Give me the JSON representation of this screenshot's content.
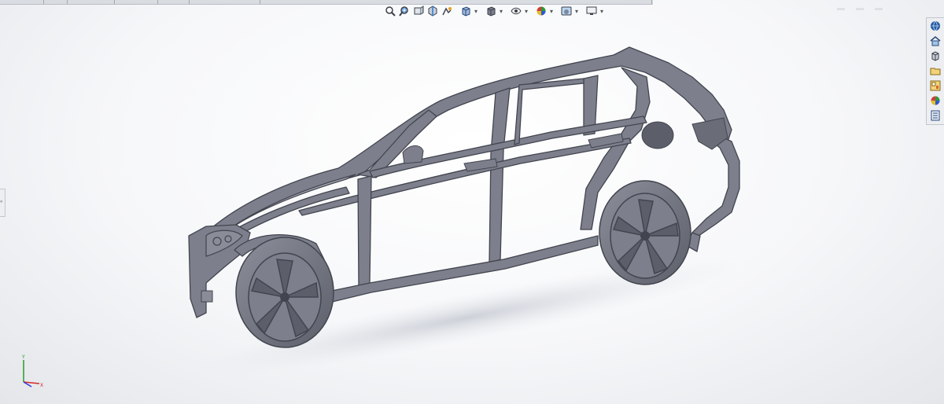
{
  "window": {
    "left_tab_glyph": "«"
  },
  "view_toolbar": {
    "tools": [
      {
        "name": "zoom-to-fit-icon"
      },
      {
        "name": "zoom-to-area-icon"
      },
      {
        "name": "previous-view-icon"
      },
      {
        "name": "section-view-icon"
      },
      {
        "name": "dynamic-annotation-icon"
      },
      {
        "name": "view-orientation-icon",
        "dropdown": true
      },
      {
        "name": "display-style-icon",
        "dropdown": true
      },
      {
        "name": "hide-show-items-icon",
        "dropdown": true
      },
      {
        "name": "edit-appearance-icon",
        "dropdown": true
      },
      {
        "name": "apply-scene-icon",
        "dropdown": true
      },
      {
        "name": "view-settings-icon",
        "dropdown": true
      }
    ],
    "dropdown_glyph": "▾"
  },
  "task_pane": {
    "buttons": [
      {
        "name": "solidworks-resources-icon"
      },
      {
        "name": "home-icon"
      },
      {
        "name": "design-library-icon"
      },
      {
        "name": "file-explorer-icon"
      },
      {
        "name": "view-palette-icon"
      },
      {
        "name": "appearances-scenes-icon"
      },
      {
        "name": "custom-properties-icon"
      }
    ]
  },
  "triad": {
    "axis_y": "Y",
    "axis_x": "X",
    "colors": {
      "x": "#d62a2a",
      "y": "#2a9a2a",
      "z": "#2a3ad6"
    }
  },
  "model": {
    "body_color": "#7d808c",
    "edge_color": "#42454f",
    "highlight_color": "#a6a9b3"
  }
}
